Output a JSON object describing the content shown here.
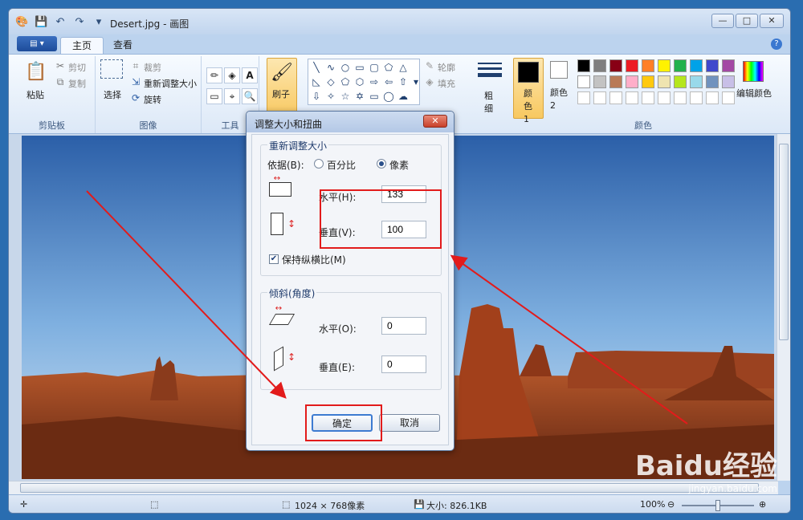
{
  "window": {
    "title": "Desert.jpg - 画图",
    "controls": {
      "minimize": "—",
      "maximize": "□",
      "close": "✕"
    }
  },
  "tabs": [
    {
      "label": "主页"
    },
    {
      "label": "查看"
    }
  ],
  "ribbon": {
    "clipboard": {
      "group": "剪贴板",
      "paste": "粘贴",
      "cut": "剪切",
      "copy": "复制"
    },
    "image": {
      "group": "图像",
      "select": "选择",
      "crop": "裁剪",
      "resize": "重新调整大小",
      "rotate": "旋转"
    },
    "tools": {
      "group": "工具"
    },
    "brushes": {
      "label": "刷子"
    },
    "shapes": {
      "outline": "轮廓",
      "fill": "填充"
    },
    "size": {
      "label": "粗细"
    },
    "colors": {
      "group": "颜色",
      "color1": "颜色 1",
      "color2": "颜色 2",
      "edit": "编辑颜色",
      "palette_row1": [
        "#000000",
        "#7f7f7f",
        "#880015",
        "#ed1c24",
        "#ff7f27",
        "#fff200",
        "#22b14c",
        "#00a2e8",
        "#3f48cc",
        "#a349a4"
      ],
      "palette_row2": [
        "#ffffff",
        "#c3c3c3",
        "#b97a57",
        "#ffaec9",
        "#ffc90e",
        "#efe4b0",
        "#b5e61d",
        "#99d9ea",
        "#7092be",
        "#c8bfe7"
      ]
    }
  },
  "dialog": {
    "title": "调整大小和扭曲",
    "resize_section": "重新调整大小",
    "by_label": "依据(B):",
    "percent": "百分比",
    "pixels": "像素",
    "horizontal_label": "水平(H):",
    "horizontal_value": "133",
    "vertical_label": "垂直(V):",
    "vertical_value": "100",
    "keep_ratio": "保持纵横比(M)",
    "skew_section": "倾斜(角度)",
    "skew_h_label": "水平(O):",
    "skew_h_value": "0",
    "skew_v_label": "垂直(E):",
    "skew_v_value": "0",
    "ok": "确定",
    "cancel": "取消"
  },
  "statusbar": {
    "dimensions": "1024 × 768像素",
    "size": "大小: 826.1KB",
    "zoom": "100%"
  },
  "watermark": {
    "brand": "Baidu经验",
    "url": "jingyan.baidu.com"
  }
}
